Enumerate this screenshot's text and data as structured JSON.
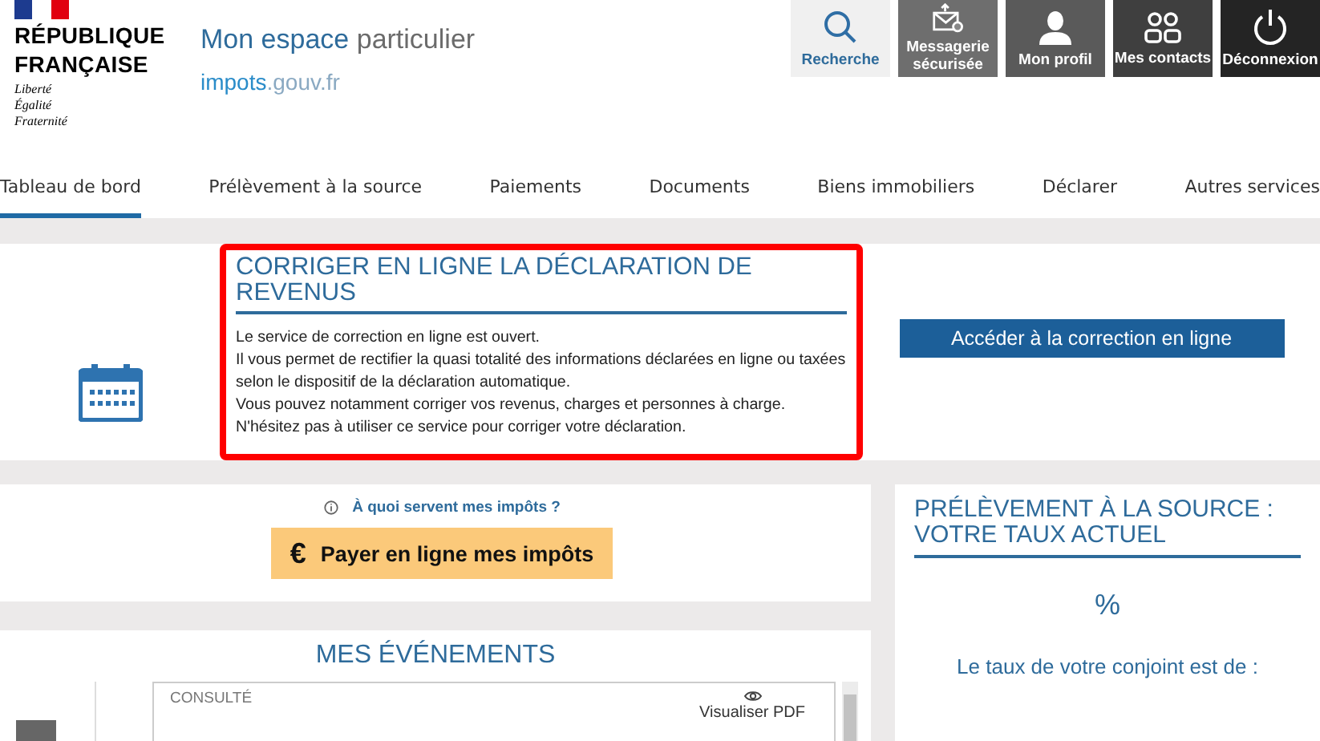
{
  "logo": {
    "name_lines": [
      "RÉPUBLIQUE",
      "FRANÇAISE"
    ],
    "motto": [
      "Liberté",
      "Égalité",
      "Fraternité"
    ]
  },
  "brand": {
    "title_main": "Mon espace",
    "title_rest": "particulier",
    "domain_main": "impots",
    "domain_rest": ".gouv.fr"
  },
  "top_buttons": [
    {
      "label": "Recherche",
      "kind": "search"
    },
    {
      "label": "Messagerie sécurisée",
      "kind": "mail"
    },
    {
      "label": "Mon profil",
      "kind": "person"
    },
    {
      "label": "Mes contacts",
      "kind": "contacts"
    },
    {
      "label": "Déconnexion",
      "kind": "power"
    }
  ],
  "tabs": [
    {
      "label": "Tableau de bord",
      "selected": true
    },
    {
      "label": "Prélèvement à la source",
      "selected": false
    },
    {
      "label": "Paiements",
      "selected": false
    },
    {
      "label": "Documents",
      "selected": false
    },
    {
      "label": "Biens immobiliers",
      "selected": false
    },
    {
      "label": "Déclarer",
      "selected": false
    },
    {
      "label": "Autres services",
      "selected": false
    }
  ],
  "notice": {
    "title": "CORRIGER EN LIGNE LA DÉCLARATION DE REVENUS",
    "lines": [
      "Le service de correction en ligne est ouvert.",
      "Il vous permet de rectifier la quasi totalité des informations déclarées en ligne ou taxées selon le dispositif de la déclaration automatique.",
      "Vous pouvez notamment corriger vos revenus, charges et personnes à charge.",
      "N'hésitez pas à utiliser ce service pour corriger votre déclaration."
    ],
    "button": "Accéder à la correction en ligne"
  },
  "payment": {
    "info_link": "À quoi servent mes impôts ?",
    "currency": "€",
    "button": "Payer en ligne mes impôts"
  },
  "rate": {
    "title": "PRÉLÈVEMENT À LA SOURCE : VOTRE TAUX ACTUEL",
    "value": "%",
    "spouse_label": "Le taux de votre conjoint est de :"
  },
  "events": {
    "title": "MES ÉVÉNEMENTS",
    "items": [
      {
        "status": "CONSULTÉ",
        "action": "Visualiser PDF"
      }
    ]
  }
}
